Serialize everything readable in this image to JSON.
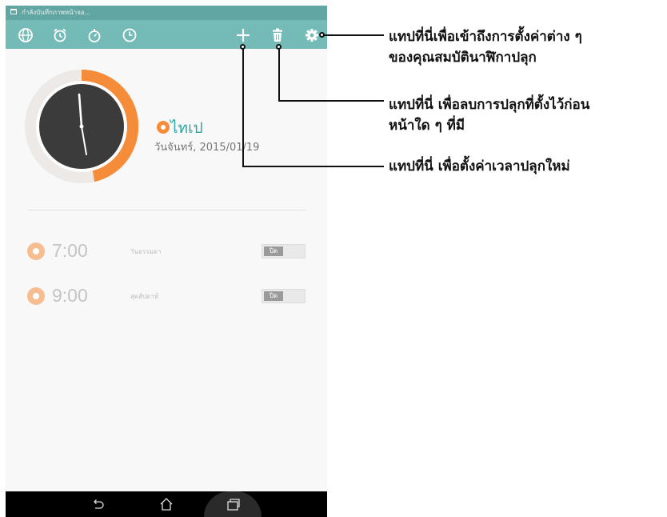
{
  "status_bar": {
    "notification_text": "กำลังบันทึกภาพหน้าจอ..."
  },
  "action_bar": {
    "icons": [
      "world-clock-icon",
      "alarm-icon",
      "stopwatch-icon",
      "timer-icon",
      "add-icon",
      "delete-icon",
      "settings-icon"
    ],
    "accent_color": "#74bab6"
  },
  "world_clock": {
    "city": "ไทเป",
    "date": "วันจันทร์, 2015/01/19",
    "clock_time": "7:00",
    "accent_color": "#f58c3a"
  },
  "alarms": [
    {
      "time": "7:00",
      "repeat": "วันธรรมดา",
      "toggle_label": "ปิด"
    },
    {
      "time": "9:00",
      "repeat": "สุดสัปดาห์",
      "toggle_label": "ปิด"
    }
  ],
  "nav_bar": {
    "icons": [
      "back-icon",
      "home-icon",
      "recent-apps-icon"
    ]
  },
  "callouts": {
    "settings": [
      "แทปที่นี่เพื่อเข้าถึงการตั้งค่าต่าง ๆ",
      "ของคุณสมบัตินาฬิกาปลุก"
    ],
    "delete": [
      "แทปที่นี่ เพื่อลบการปลุกที่ตั้งไว้ก่อน",
      "หน้าใด ๆ ที่มี"
    ],
    "add": [
      "แทปที่นี่ เพื่อตั้งค่าเวลาปลุกใหม่"
    ]
  }
}
